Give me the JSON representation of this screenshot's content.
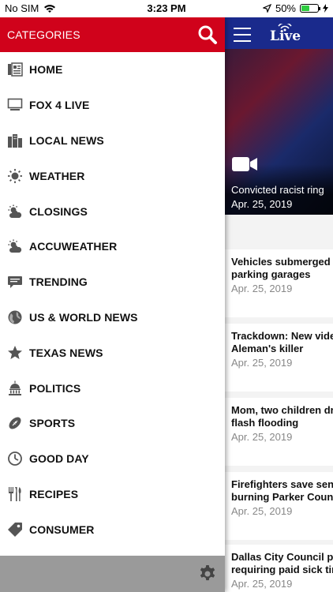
{
  "status_bar": {
    "carrier": "No SIM",
    "time": "3:23 PM",
    "battery": "50%",
    "battery_level": 0.5
  },
  "drawer": {
    "title": "CATEGORIES",
    "items": [
      {
        "label": "HOME",
        "icon": "newspaper-icon"
      },
      {
        "label": "FOX 4 LIVE",
        "icon": "tv-icon"
      },
      {
        "label": "LOCAL NEWS",
        "icon": "city-icon"
      },
      {
        "label": "WEATHER",
        "icon": "sun-icon"
      },
      {
        "label": "CLOSINGS",
        "icon": "cloudy-sun-icon"
      },
      {
        "label": "ACCUWEATHER",
        "icon": "cloudy-sun-icon"
      },
      {
        "label": "TRENDING",
        "icon": "chat-bubble-icon"
      },
      {
        "label": "US & WORLD NEWS",
        "icon": "globe-icon"
      },
      {
        "label": "TEXAS NEWS",
        "icon": "star-icon"
      },
      {
        "label": "POLITICS",
        "icon": "capitol-icon"
      },
      {
        "label": "SPORTS",
        "icon": "football-icon"
      },
      {
        "label": "GOOD DAY",
        "icon": "clock-icon"
      },
      {
        "label": "RECIPES",
        "icon": "utensils-icon"
      },
      {
        "label": "CONSUMER",
        "icon": "tag-icon"
      }
    ]
  },
  "main": {
    "logo_text": "Live",
    "hero": {
      "title": "Convicted racist ring",
      "date": "Apr. 25, 2019"
    },
    "stories": [
      {
        "title_line1": "Vehicles submerged i",
        "title_line2": "parking garages",
        "date": "Apr. 25, 2019"
      },
      {
        "title_line1": "Trackdown: New vide",
        "title_line2": "Aleman's killer",
        "date": "Apr. 25, 2019"
      },
      {
        "title_line1": "Mom, two children dr",
        "title_line2": "flash flooding",
        "date": "Apr. 25, 2019"
      },
      {
        "title_line1": "Firefighters save seni",
        "title_line2": "burning Parker Count",
        "date": "Apr. 25, 2019"
      },
      {
        "title_line1": "Dallas City Council pa",
        "title_line2": "requiring paid sick tir",
        "date": "Apr. 25, 2019"
      }
    ]
  },
  "colors": {
    "drawer_header": "#d0021b",
    "main_header": "#1a2a8c",
    "footer": "#9a9a9a"
  }
}
